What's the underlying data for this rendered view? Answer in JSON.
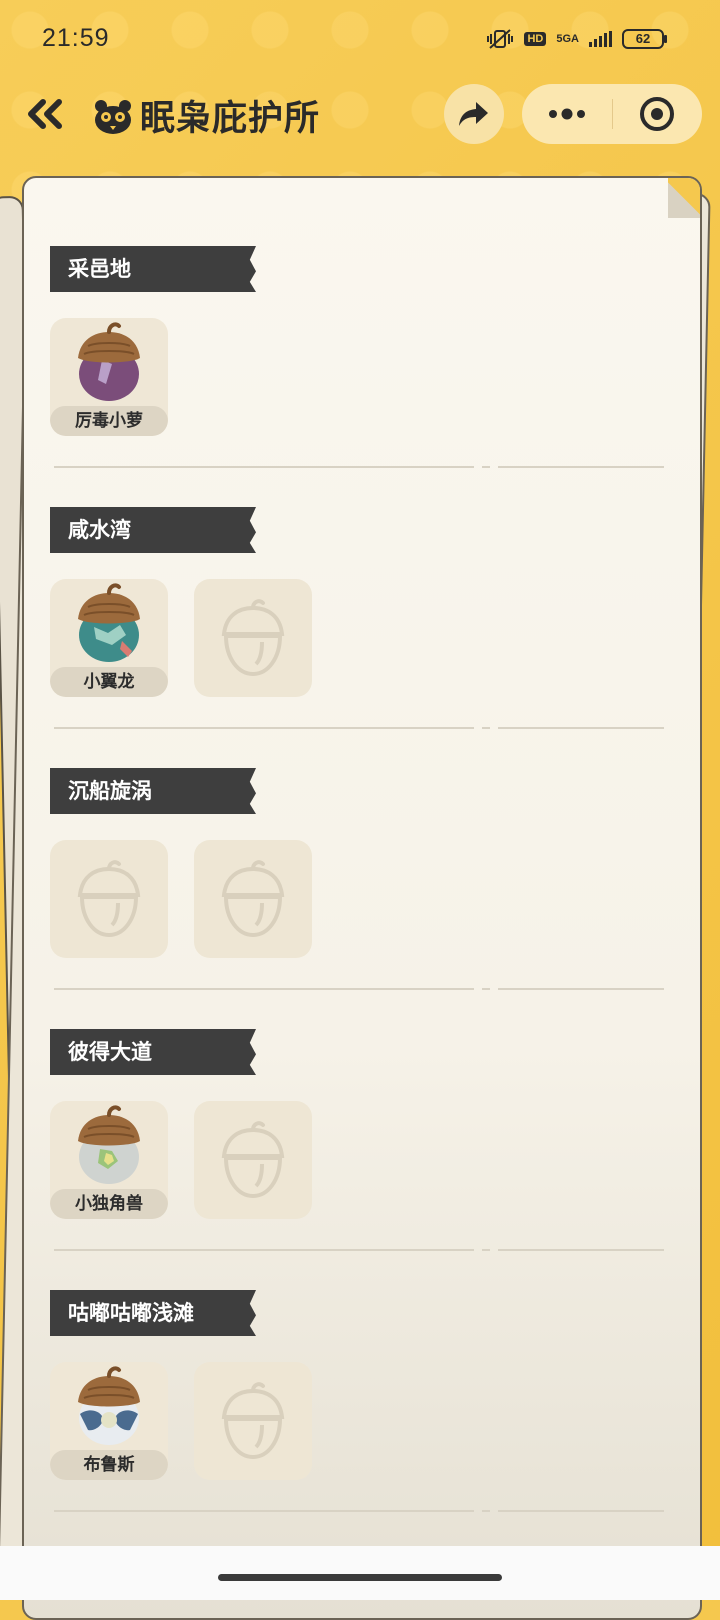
{
  "status_bar": {
    "time": "21:59",
    "network": "5GA",
    "battery": "62",
    "hd": "HD"
  },
  "header": {
    "title": "眠枭庇护所"
  },
  "sections": [
    {
      "label": "采邑地",
      "slots": [
        {
          "name": "厉毒小萝",
          "colors": [
            "#7b4d7a",
            "#b9a0c8"
          ]
        }
      ]
    },
    {
      "label": "咸水湾",
      "slots": [
        {
          "name": "小翼龙",
          "colors": [
            "#3e8c8a",
            "#d97c72"
          ]
        },
        {
          "name": "",
          "empty": true
        }
      ]
    },
    {
      "label": "沉船旋涡",
      "slots": [
        {
          "name": "",
          "empty": true
        },
        {
          "name": "",
          "empty": true
        }
      ]
    },
    {
      "label": "彼得大道",
      "slots": [
        {
          "name": "小独角兽",
          "colors": [
            "#cfd3d0",
            "#9bc47a"
          ]
        },
        {
          "name": "",
          "empty": true
        }
      ]
    },
    {
      "label": "咕嘟咕嘟浅滩",
      "slots": [
        {
          "name": "布鲁斯",
          "colors": [
            "#e8ecf0",
            "#4a6b8f"
          ]
        },
        {
          "name": "",
          "empty": true
        }
      ]
    }
  ],
  "colors": {
    "accent": "#f5c84e",
    "label_bg": "#3e3e3e",
    "paper": "#faf7ef"
  }
}
